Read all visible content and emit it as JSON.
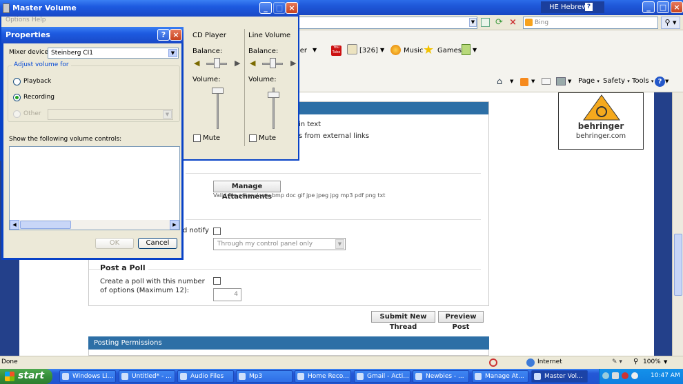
{
  "ie": {
    "language_bar": "HE Hebrew",
    "search_placeholder": "Bing",
    "toolbar": {
      "item_er": "ier",
      "count": "[326]",
      "music": "Music",
      "games": "Games"
    },
    "cmd": {
      "page": "Page",
      "safety": "Safety",
      "tools": "Tools"
    },
    "status": {
      "done": "Done",
      "zone": "Internet",
      "zoom": "100%"
    }
  },
  "forum": {
    "text_line1": "in text",
    "text_line2": "s from external links",
    "manage_attachments": "Manage Attachments",
    "valid_ext": "Valid file extensions: bmp doc gif jpe jpeg jpg mp3 pdf png txt",
    "notify_label": "d notify",
    "notify_select": "Through my control panel only",
    "post_poll_heading": "Post a Poll",
    "poll_label": "Create a poll with this number of options (Maximum 12):",
    "poll_value": "4",
    "submit_button": "Submit New Thread",
    "preview_button": "Preview Post",
    "permissions_heading": "Posting Permissions",
    "ad_brand": "behringer",
    "ad_url": "behringer.com"
  },
  "master_volume": {
    "title": "Master Volume",
    "menu_options": "Options",
    "menu_help": "Help",
    "col1": {
      "title": "CD Player",
      "balance": "Balance:",
      "volume": "Volume:",
      "mute": "Mute"
    },
    "col2": {
      "title": "Line Volume",
      "balance": "Balance:",
      "volume": "Volume:",
      "mute": "Mute"
    }
  },
  "properties": {
    "title": "Properties",
    "mixer_label": "Mixer device:",
    "mixer_value": "Steinberg CI1",
    "adjust_group": "Adjust volume for",
    "playback": "Playback",
    "recording": "Recording",
    "other": "Other",
    "show_controls": "Show the following volume controls:",
    "ok": "OK",
    "cancel": "Cancel"
  },
  "taskbar": {
    "start": "start",
    "tasks": [
      "Windows Li...",
      "Untitled* - ...",
      "Audio Files",
      "Mp3",
      "Home Reco...",
      "Gmail - Acti...",
      "Newbies - ...",
      "Manage At...",
      "Master Vol..."
    ],
    "clock": "10:47 AM"
  }
}
